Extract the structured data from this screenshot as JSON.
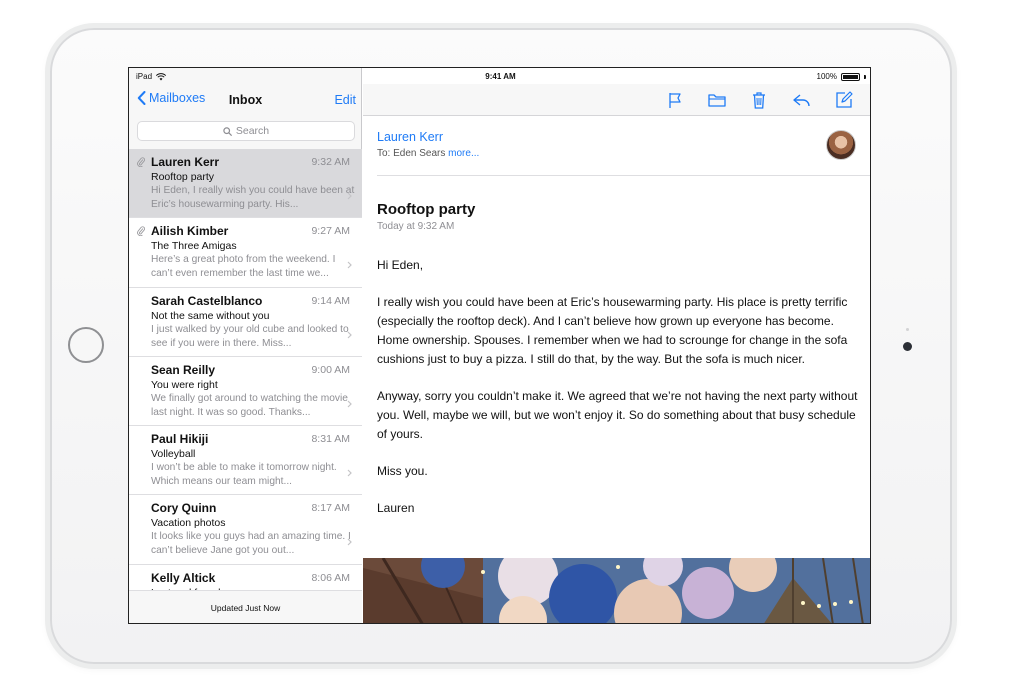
{
  "status_bar": {
    "device": "iPad",
    "time": "9:41 AM",
    "battery": "100%"
  },
  "list": {
    "back_label": "Mailboxes",
    "title": "Inbox",
    "edit_label": "Edit",
    "search_placeholder": "Search",
    "footer": "Updated Just Now",
    "messages": [
      {
        "sender": "Lauren Kerr",
        "time": "9:32 AM",
        "subject": "Rooftop party",
        "preview": "Hi Eden, I really wish you could have been at Eric’s housewarming party. His..."
      },
      {
        "sender": "Ailish Kimber",
        "time": "9:27 AM",
        "subject": "The Three Amigas",
        "preview": "Here’s a great photo from the weekend. I can’t even remember the last time we..."
      },
      {
        "sender": "Sarah Castelblanco",
        "time": "9:14 AM",
        "subject": "Not the same without you",
        "preview": "I just walked by your old cube and looked to see if you were in there. Miss..."
      },
      {
        "sender": "Sean Reilly",
        "time": "9:00 AM",
        "subject": "You were right",
        "preview": "We finally got around to watching the movie last night. It was so good. Thanks..."
      },
      {
        "sender": "Paul Hikiji",
        "time": "8:31 AM",
        "subject": "Volleyball",
        "preview": "I won’t be able to make it tomorrow night. Which means our team might..."
      },
      {
        "sender": "Cory Quinn",
        "time": "8:17 AM",
        "subject": "Vacation photos",
        "preview": "It looks like you guys had an amazing time. I can’t believe Jane got you out..."
      },
      {
        "sender": "Kelly Altick",
        "time": "8:06 AM",
        "subject": "Lost and found",
        "preview": ""
      }
    ]
  },
  "message": {
    "from": "Lauren Kerr",
    "to_prefix": "To: Eden Sears",
    "to_more": "more...",
    "subject": "Rooftop party",
    "date": "Today at 9:32 AM",
    "greeting": "Hi Eden,",
    "paragraph1": "I really wish you could have been at Eric’s housewarming party. His place is pretty terrific (especially the rooftop deck). And I can’t believe how grown up everyone has become. Home ownership. Spouses. I remember when we had to scrounge for change in the sofa cushions just to buy a pizza. I still do that, by the way. But the sofa is much nicer.",
    "paragraph2": "Anyway, sorry you couldn’t make it. We agreed that we’re not having the next party without you. Well, maybe we will, but we won’t enjoy it. So do something about that busy schedule of yours.",
    "closing": "Miss you.",
    "signature": "Lauren"
  },
  "colors": {
    "accent": "#1f7bf6",
    "selected_row": "#d9d9dc",
    "secondary_text": "#8e8e93"
  },
  "icons": {
    "toolbar": [
      "flag-icon",
      "folder-icon",
      "trash-icon",
      "reply-icon",
      "compose-icon"
    ]
  }
}
